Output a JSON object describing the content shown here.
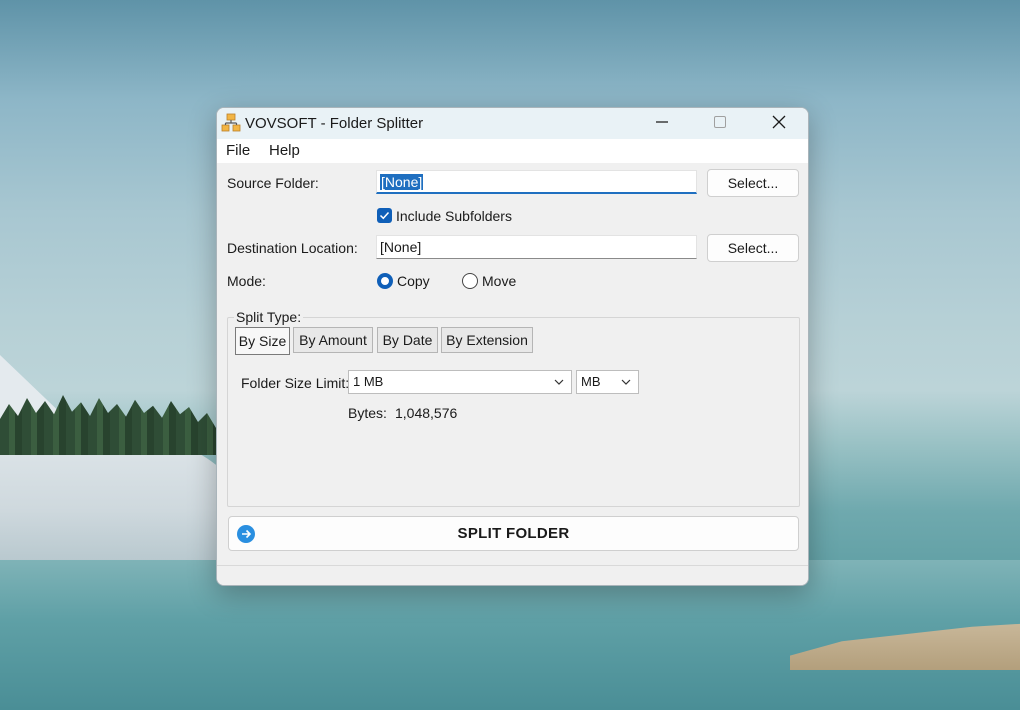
{
  "window": {
    "title": "VOVSOFT - Folder Splitter",
    "app_icon": "network-folders-icon",
    "controls": [
      "minimize-icon",
      "maximize-icon",
      "close-icon"
    ]
  },
  "menu": {
    "file": "File",
    "help": "Help"
  },
  "source": {
    "label": "Source Folder:",
    "value": "[None]",
    "button": "Select..."
  },
  "subfolders": {
    "label": "Include Subfolders",
    "checked": true
  },
  "destination": {
    "label": "Destination Location:",
    "value": "[None]",
    "button": "Select..."
  },
  "mode": {
    "label": "Mode:",
    "options": [
      {
        "label": "Copy",
        "selected": true
      },
      {
        "label": "Move",
        "selected": false
      }
    ]
  },
  "split_type": {
    "title": "Split Type:",
    "tabs": [
      {
        "label": "By Size",
        "active": true
      },
      {
        "label": "By Amount",
        "active": false
      },
      {
        "label": "By Date",
        "active": false
      },
      {
        "label": "By Extension",
        "active": false
      }
    ],
    "size_limit_label": "Folder Size Limit:",
    "size_value": "1 MB",
    "unit_value": "MB",
    "bytes_label": "Bytes:",
    "bytes_value": "1,048,576"
  },
  "action": {
    "label": "SPLIT FOLDER",
    "icon": "arrow-right-circle-icon"
  },
  "colors": {
    "accent": "#0f5fb8",
    "titlebar": "#e9f2f6",
    "window_bg": "#f0f0f0"
  }
}
